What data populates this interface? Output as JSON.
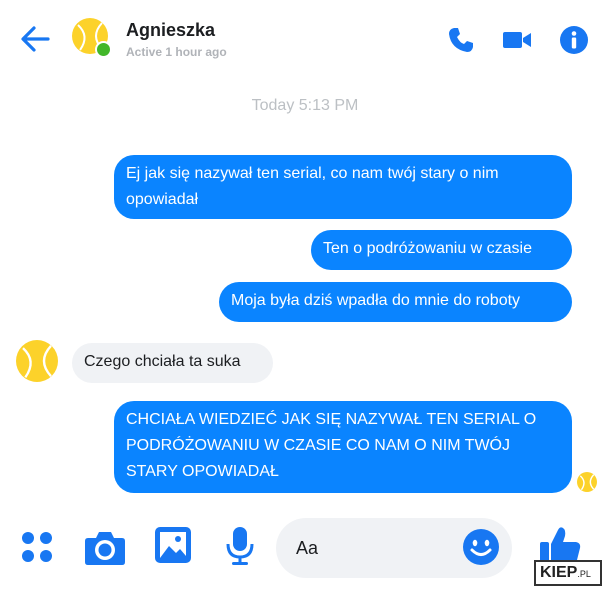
{
  "header": {
    "name": "Agnieszka",
    "status": "Active 1 hour ago"
  },
  "timestamp": "Today 5:13 PM",
  "messages": [
    {
      "from": "me",
      "text": "Ej jak się nazywał ten serial, co nam twój stary o nim opowiadał"
    },
    {
      "from": "me",
      "text": "Ten o podróżowaniu w czasie"
    },
    {
      "from": "me",
      "text": "Moja była dziś wpadła do mnie do roboty"
    },
    {
      "from": "them",
      "text": "Czego chciała ta suka"
    },
    {
      "from": "me",
      "text": "CHCIAŁA WIEDZIEĆ JAK SIĘ NAZYWAŁ TEN SERIAL O PODRÓŻOWANIU W CZASIE CO NAM O NIM TWÓJ STARY OPOWIADAŁ"
    }
  ],
  "composer": {
    "placeholder": "Aa"
  },
  "watermark": {
    "main": "KIEP",
    "suffix": ".PL"
  },
  "colors": {
    "accent": "#0a84ff",
    "icon_blue": "#1877f2",
    "avatar": "#fcd22a",
    "online": "#42b72a"
  },
  "icons": [
    "back-arrow-icon",
    "phone-icon",
    "video-camera-icon",
    "info-icon",
    "apps-grid-icon",
    "camera-icon",
    "gallery-icon",
    "microphone-icon",
    "emoji-icon",
    "thumbs-up-icon"
  ]
}
